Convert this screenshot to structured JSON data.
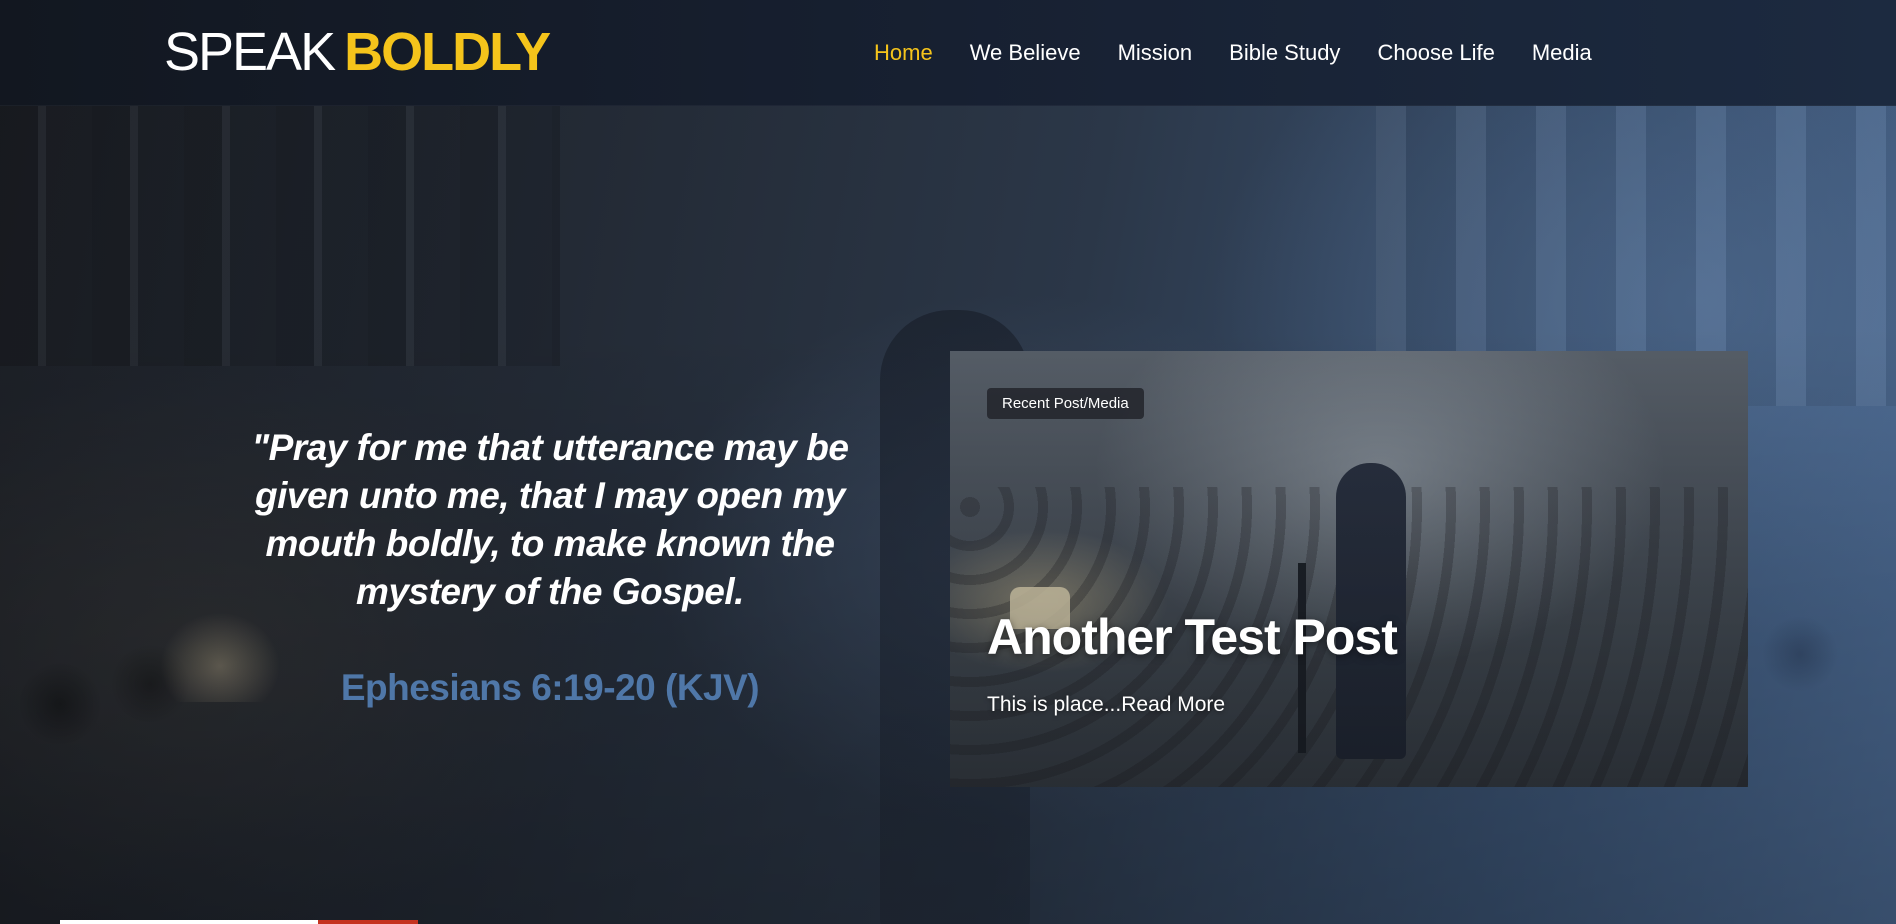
{
  "header": {
    "logo_regular": "SPEAK",
    "logo_bold": "BOLDLY",
    "nav": [
      {
        "label": "Home",
        "active": true
      },
      {
        "label": "We Believe",
        "active": false
      },
      {
        "label": "Mission",
        "active": false
      },
      {
        "label": "Bible Study",
        "active": false
      },
      {
        "label": "Choose Life",
        "active": false
      },
      {
        "label": "Media",
        "active": false
      }
    ]
  },
  "hero": {
    "quote": "\"Pray for me that utterance may be given unto me, that I may open my mouth boldly, to make known the mystery of the Gospel.",
    "reference": "Ephesians 6:19-20 (KJV)"
  },
  "recent_post": {
    "badge": "Recent Post/Media",
    "title": "Another Test Post",
    "excerpt": "This is place...",
    "read_more": "Read More"
  },
  "colors": {
    "accent": "#f5c41b",
    "reference_blue": "#4f77a8",
    "header_bg": "#172031"
  }
}
